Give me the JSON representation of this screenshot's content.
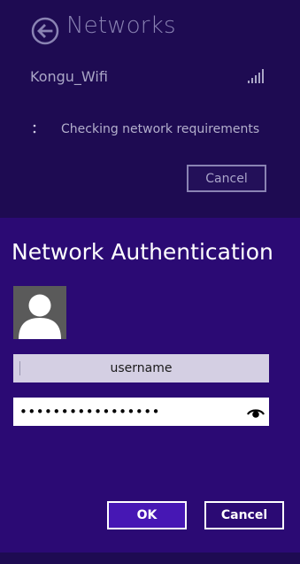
{
  "networks_panel": {
    "title": "Networks",
    "back_icon": "back-arrow-circle-icon",
    "network": {
      "name": "Kongu_Wifi",
      "signal_icon": "wifi-signal-bars-icon"
    },
    "status": {
      "spinner_icon": "progress-dots-icon",
      "text": "Checking network requirements"
    },
    "cancel_label": "Cancel"
  },
  "auth_dialog": {
    "title": "Network Authentication",
    "avatar_icon": "user-avatar-icon",
    "username": {
      "value": "",
      "placeholder": "username"
    },
    "password": {
      "value": "•••••••••••••••••",
      "reveal_icon": "eye-reveal-icon"
    },
    "ok_label": "OK",
    "cancel_label": "Cancel"
  },
  "colors": {
    "background": "#1e0b52",
    "dialog_background": "#2b0a74",
    "ok_button": "#4617b4",
    "dim_text": "#8a83b3"
  }
}
